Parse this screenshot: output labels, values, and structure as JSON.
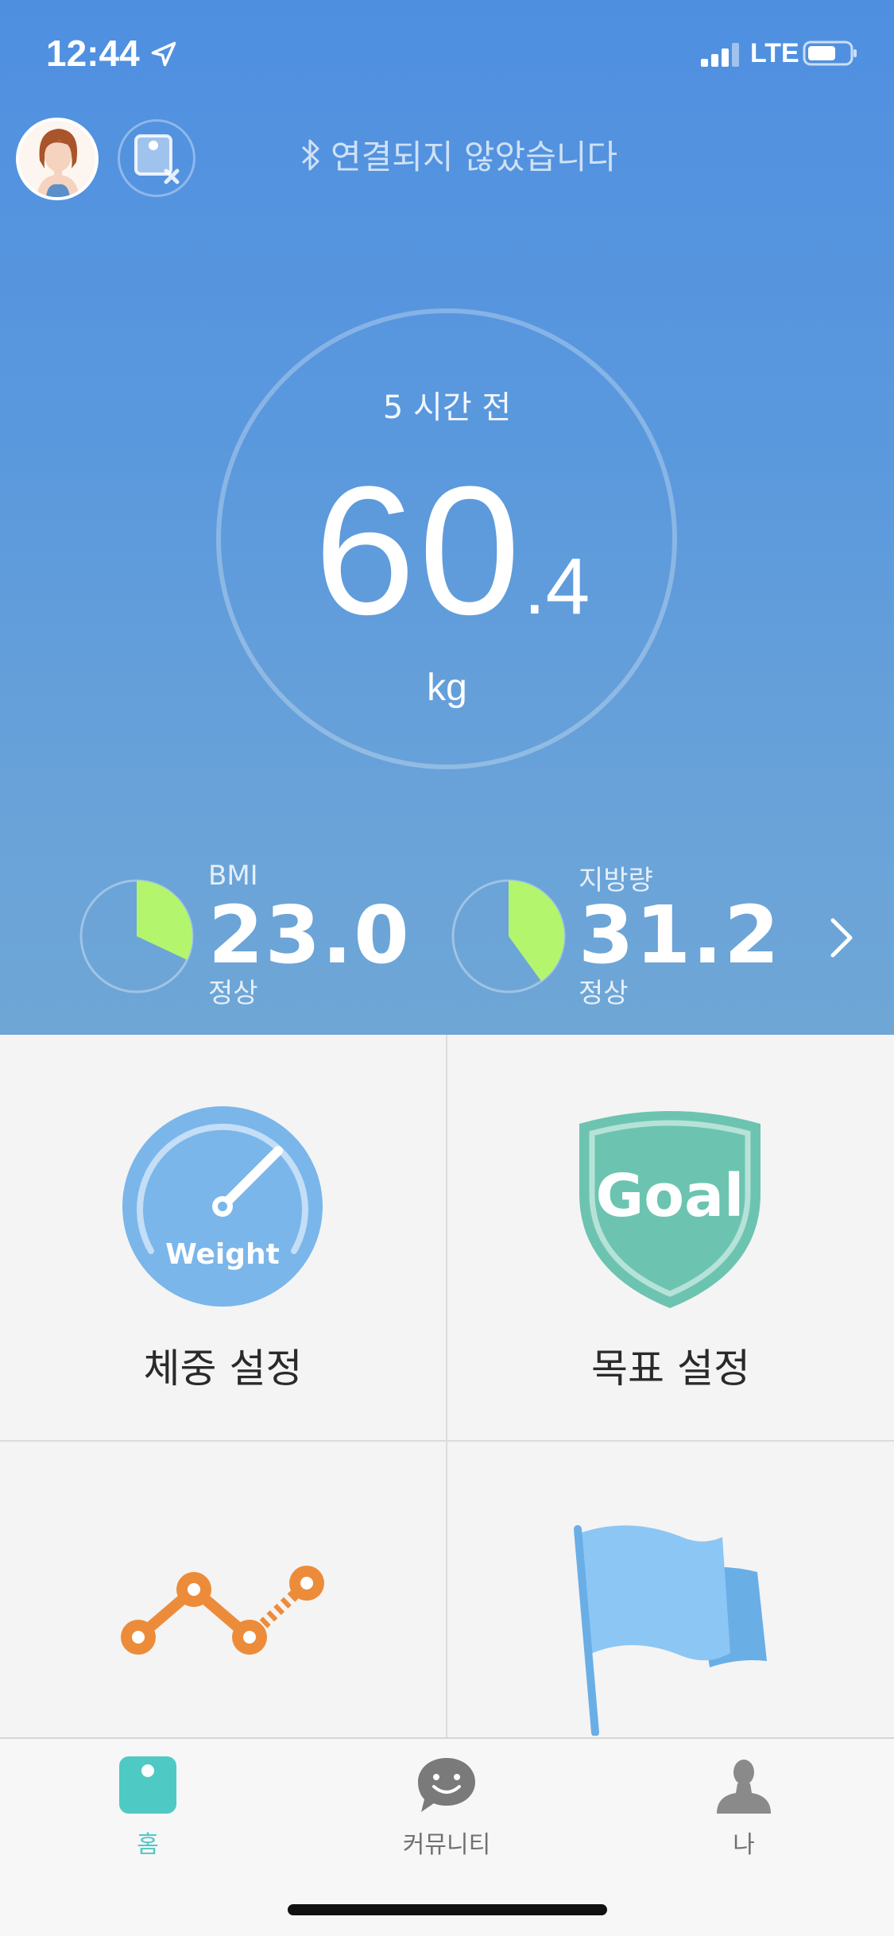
{
  "status_bar": {
    "time": "12:44",
    "network": "LTE",
    "icons": [
      "location-arrow-icon",
      "signal-icon",
      "battery-icon"
    ]
  },
  "header": {
    "connection_status": "연결되지 않았습니다",
    "icons": [
      "avatar",
      "scale-disconnected-icon",
      "bluetooth-icon"
    ]
  },
  "measurement": {
    "time_ago": "5 시간 전",
    "weight_integer": "60",
    "weight_decimal": ".4",
    "unit": "kg"
  },
  "metrics": [
    {
      "label": "BMI",
      "value": "23.0",
      "status": "정상",
      "pie_fraction": 0.32
    },
    {
      "label": "지방량",
      "value": "31.2",
      "status": "정상",
      "pie_fraction": 0.4
    }
  ],
  "menu": [
    {
      "label": "체중 설정",
      "icon": "weight-gauge-icon",
      "badge_text": "Weight"
    },
    {
      "label": "목표 설정",
      "icon": "goal-shield-icon",
      "badge_text": "Goal"
    },
    {
      "label": "",
      "icon": "trend-line-icon"
    },
    {
      "label": "",
      "icon": "flag-icon"
    }
  ],
  "tabs": [
    {
      "label": "홈",
      "icon": "home-scale-icon",
      "active": true
    },
    {
      "label": "커뮤니티",
      "icon": "chat-bubble-icon",
      "active": false
    },
    {
      "label": "나",
      "icon": "person-icon",
      "active": false
    }
  ],
  "colors": {
    "accent": "#4ec9c4",
    "hero_top": "#4f8fe0",
    "hero_bottom": "#6ea6d6",
    "pie_fill": "#b4f56e",
    "weight_blue": "#7ab6ea",
    "goal_green": "#6cc4b0",
    "trend_orange": "#ec8c3a",
    "flag_blue": "#8cc6f4"
  }
}
